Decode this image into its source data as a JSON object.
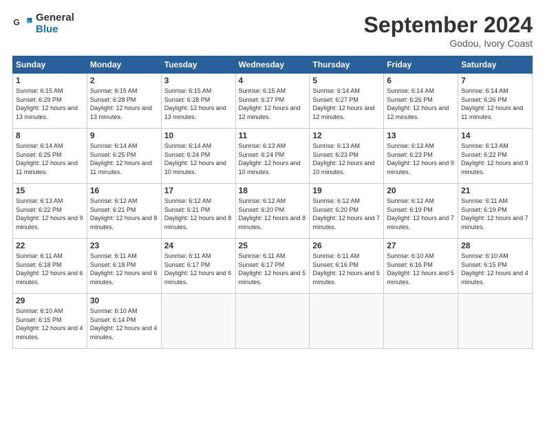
{
  "header": {
    "logo_line1": "General",
    "logo_line2": "Blue",
    "month": "September 2024",
    "location": "Godou, Ivory Coast"
  },
  "weekdays": [
    "Sunday",
    "Monday",
    "Tuesday",
    "Wednesday",
    "Thursday",
    "Friday",
    "Saturday"
  ],
  "weeks": [
    [
      {
        "day": "1",
        "sunrise": "Sunrise: 6:15 AM",
        "sunset": "Sunset: 6:29 PM",
        "daylight": "Daylight: 12 hours and 13 minutes."
      },
      {
        "day": "2",
        "sunrise": "Sunrise: 6:15 AM",
        "sunset": "Sunset: 6:28 PM",
        "daylight": "Daylight: 12 hours and 13 minutes."
      },
      {
        "day": "3",
        "sunrise": "Sunrise: 6:15 AM",
        "sunset": "Sunset: 6:28 PM",
        "daylight": "Daylight: 12 hours and 13 minutes."
      },
      {
        "day": "4",
        "sunrise": "Sunrise: 6:15 AM",
        "sunset": "Sunset: 6:27 PM",
        "daylight": "Daylight: 12 hours and 12 minutes."
      },
      {
        "day": "5",
        "sunrise": "Sunrise: 6:14 AM",
        "sunset": "Sunset: 6:27 PM",
        "daylight": "Daylight: 12 hours and 12 minutes."
      },
      {
        "day": "6",
        "sunrise": "Sunrise: 6:14 AM",
        "sunset": "Sunset: 6:26 PM",
        "daylight": "Daylight: 12 hours and 12 minutes."
      },
      {
        "day": "7",
        "sunrise": "Sunrise: 6:14 AM",
        "sunset": "Sunset: 6:26 PM",
        "daylight": "Daylight: 12 hours and 11 minutes."
      }
    ],
    [
      {
        "day": "8",
        "sunrise": "Sunrise: 6:14 AM",
        "sunset": "Sunset: 6:25 PM",
        "daylight": "Daylight: 12 hours and 11 minutes."
      },
      {
        "day": "9",
        "sunrise": "Sunrise: 6:14 AM",
        "sunset": "Sunset: 6:25 PM",
        "daylight": "Daylight: 12 hours and 11 minutes."
      },
      {
        "day": "10",
        "sunrise": "Sunrise: 6:14 AM",
        "sunset": "Sunset: 6:24 PM",
        "daylight": "Daylight: 12 hours and 10 minutes."
      },
      {
        "day": "11",
        "sunrise": "Sunrise: 6:13 AM",
        "sunset": "Sunset: 6:24 PM",
        "daylight": "Daylight: 12 hours and 10 minutes."
      },
      {
        "day": "12",
        "sunrise": "Sunrise: 6:13 AM",
        "sunset": "Sunset: 6:23 PM",
        "daylight": "Daylight: 12 hours and 10 minutes."
      },
      {
        "day": "13",
        "sunrise": "Sunrise: 6:13 AM",
        "sunset": "Sunset: 6:23 PM",
        "daylight": "Daylight: 12 hours and 9 minutes."
      },
      {
        "day": "14",
        "sunrise": "Sunrise: 6:13 AM",
        "sunset": "Sunset: 6:22 PM",
        "daylight": "Daylight: 12 hours and 9 minutes."
      }
    ],
    [
      {
        "day": "15",
        "sunrise": "Sunrise: 6:13 AM",
        "sunset": "Sunset: 6:22 PM",
        "daylight": "Daylight: 12 hours and 9 minutes."
      },
      {
        "day": "16",
        "sunrise": "Sunrise: 6:12 AM",
        "sunset": "Sunset: 6:21 PM",
        "daylight": "Daylight: 12 hours and 8 minutes."
      },
      {
        "day": "17",
        "sunrise": "Sunrise: 6:12 AM",
        "sunset": "Sunset: 6:21 PM",
        "daylight": "Daylight: 12 hours and 8 minutes."
      },
      {
        "day": "18",
        "sunrise": "Sunrise: 6:12 AM",
        "sunset": "Sunset: 6:20 PM",
        "daylight": "Daylight: 12 hours and 8 minutes."
      },
      {
        "day": "19",
        "sunrise": "Sunrise: 6:12 AM",
        "sunset": "Sunset: 6:20 PM",
        "daylight": "Daylight: 12 hours and 7 minutes."
      },
      {
        "day": "20",
        "sunrise": "Sunrise: 6:12 AM",
        "sunset": "Sunset: 6:19 PM",
        "daylight": "Daylight: 12 hours and 7 minutes."
      },
      {
        "day": "21",
        "sunrise": "Sunrise: 6:11 AM",
        "sunset": "Sunset: 6:19 PM",
        "daylight": "Daylight: 12 hours and 7 minutes."
      }
    ],
    [
      {
        "day": "22",
        "sunrise": "Sunrise: 6:11 AM",
        "sunset": "Sunset: 6:18 PM",
        "daylight": "Daylight: 12 hours and 6 minutes."
      },
      {
        "day": "23",
        "sunrise": "Sunrise: 6:11 AM",
        "sunset": "Sunset: 6:18 PM",
        "daylight": "Daylight: 12 hours and 6 minutes."
      },
      {
        "day": "24",
        "sunrise": "Sunrise: 6:11 AM",
        "sunset": "Sunset: 6:17 PM",
        "daylight": "Daylight: 12 hours and 6 minutes."
      },
      {
        "day": "25",
        "sunrise": "Sunrise: 6:11 AM",
        "sunset": "Sunset: 6:17 PM",
        "daylight": "Daylight: 12 hours and 5 minutes."
      },
      {
        "day": "26",
        "sunrise": "Sunrise: 6:11 AM",
        "sunset": "Sunset: 6:16 PM",
        "daylight": "Daylight: 12 hours and 5 minutes."
      },
      {
        "day": "27",
        "sunrise": "Sunrise: 6:10 AM",
        "sunset": "Sunset: 6:16 PM",
        "daylight": "Daylight: 12 hours and 5 minutes."
      },
      {
        "day": "28",
        "sunrise": "Sunrise: 6:10 AM",
        "sunset": "Sunset: 6:15 PM",
        "daylight": "Daylight: 12 hours and 4 minutes."
      }
    ],
    [
      {
        "day": "29",
        "sunrise": "Sunrise: 6:10 AM",
        "sunset": "Sunset: 6:15 PM",
        "daylight": "Daylight: 12 hours and 4 minutes."
      },
      {
        "day": "30",
        "sunrise": "Sunrise: 6:10 AM",
        "sunset": "Sunset: 6:14 PM",
        "daylight": "Daylight: 12 hours and 4 minutes."
      },
      {
        "day": "",
        "sunrise": "",
        "sunset": "",
        "daylight": ""
      },
      {
        "day": "",
        "sunrise": "",
        "sunset": "",
        "daylight": ""
      },
      {
        "day": "",
        "sunrise": "",
        "sunset": "",
        "daylight": ""
      },
      {
        "day": "",
        "sunrise": "",
        "sunset": "",
        "daylight": ""
      },
      {
        "day": "",
        "sunrise": "",
        "sunset": "",
        "daylight": ""
      }
    ]
  ]
}
